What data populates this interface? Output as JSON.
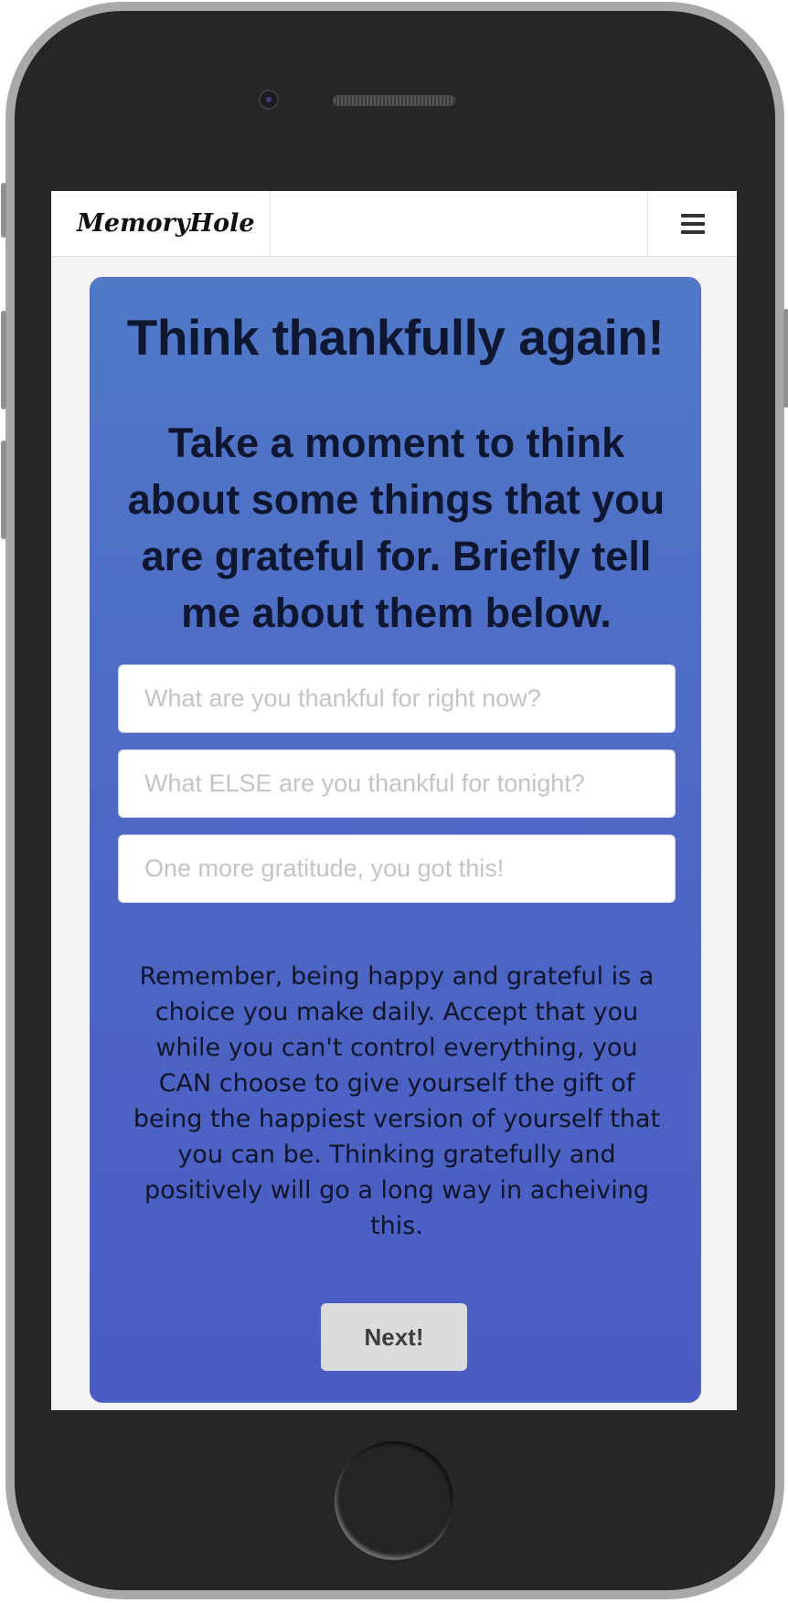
{
  "app": {
    "brand": "MemoryHole"
  },
  "navbar": {
    "menu_icon": "hamburger-menu-icon"
  },
  "card": {
    "title": "Think thankfully again!",
    "subtitle": "Take a moment to think about some things that you are grateful for. Briefly tell me about them below.",
    "inputs": [
      {
        "value": "",
        "placeholder": "What are you thankful for right now?"
      },
      {
        "value": "",
        "placeholder": "What ELSE are you thankful for tonight?"
      },
      {
        "value": "",
        "placeholder": "One more gratitude, you got this!"
      }
    ],
    "note": "Remember, being happy and grateful is a choice you make daily. Accept that you while you can't control everything, you CAN choose to give yourself the gift of being the happiest version of yourself that you can be. Thinking gratefully and positively will go a long way in acheiving this.",
    "next_label": "Next!"
  },
  "colors": {
    "card_gradient_top": "#5079c8",
    "card_gradient_bottom": "#4a5cc4",
    "heading_text": "#0e1630",
    "button_bg": "#dcdcde"
  }
}
